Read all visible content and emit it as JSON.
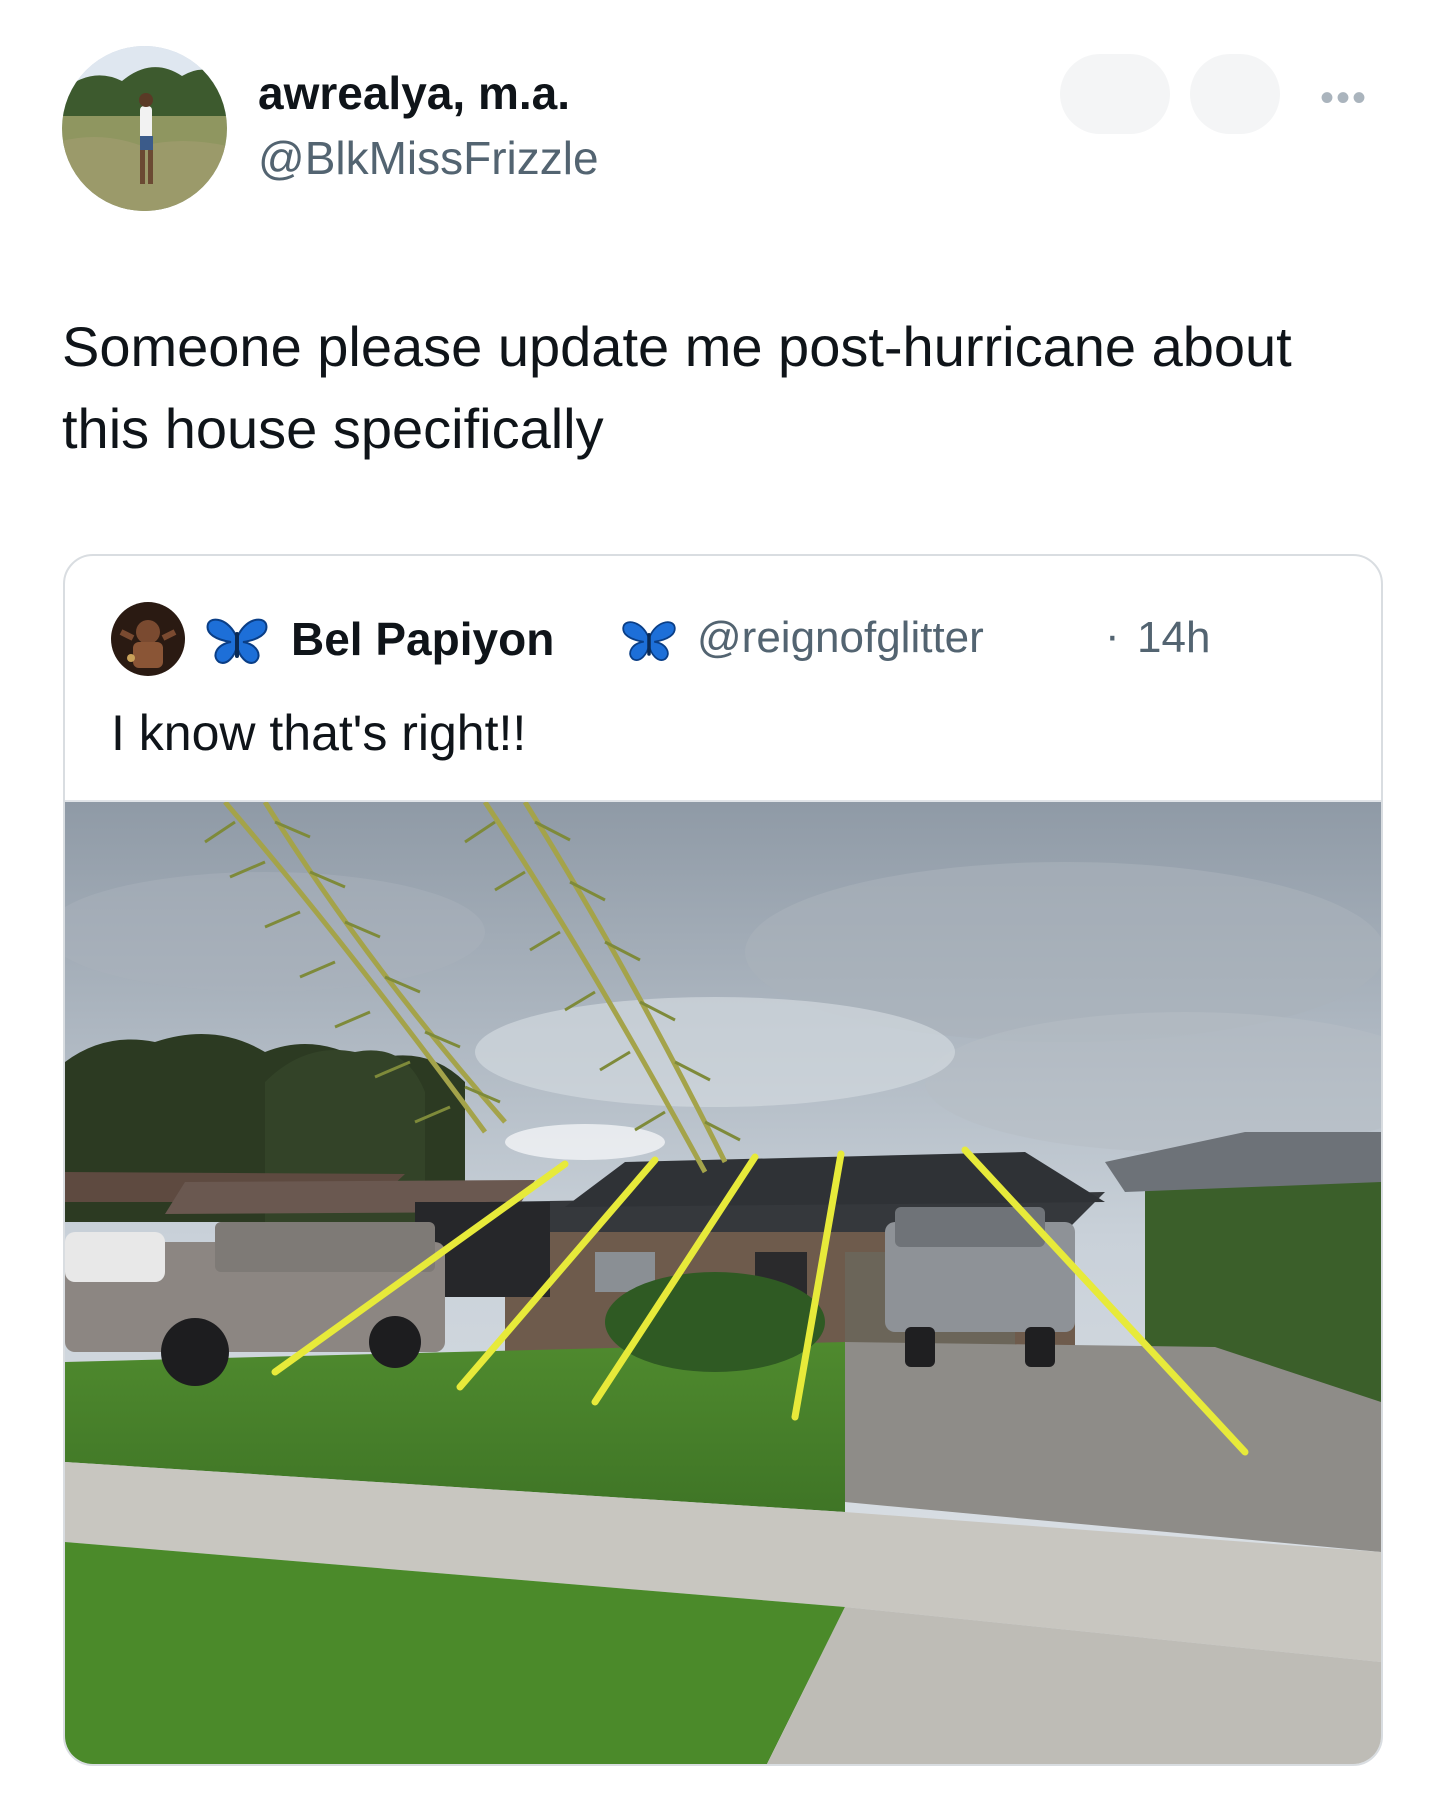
{
  "author": {
    "display_name": "awrealya, m.a.",
    "handle": "@BlkMissFrizzle",
    "more_icon": "more-horizontal-icon"
  },
  "tweet": {
    "text": "Someone please update me post-hurricane about this house specifically"
  },
  "quoted_tweet": {
    "display_name": "Bel Papiyon",
    "badge_icon": "blue-butterfly-icon",
    "handle": "@reignofglitter",
    "separator": "·",
    "time": "14h",
    "text": "I know that's right!!"
  },
  "colors": {
    "text_primary": "#0f1419",
    "text_secondary": "#536471",
    "border": "#d9dde1",
    "butterfly_blue": "#1d6fd8",
    "strap_yellow": "#e7ea3a"
  }
}
